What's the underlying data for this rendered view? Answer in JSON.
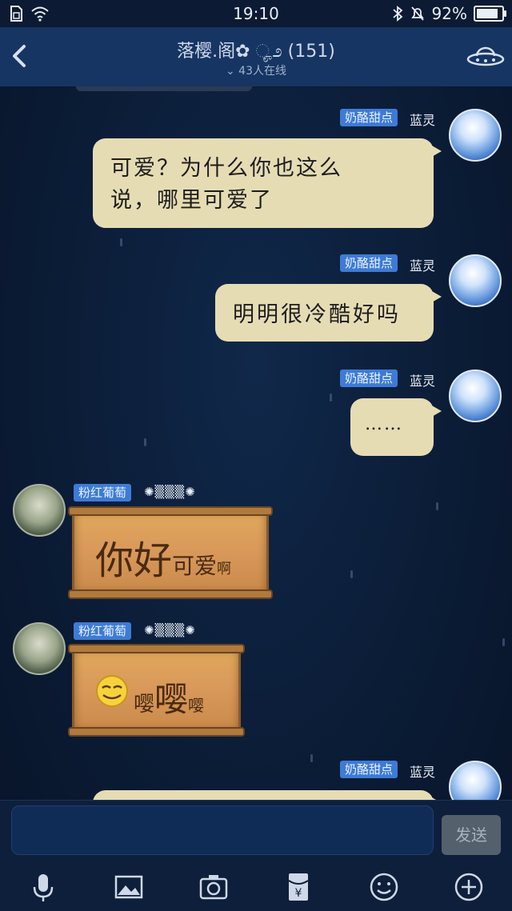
{
  "status_bar": {
    "time": "19:10",
    "battery_percent": "92%",
    "battery_level": 0.92
  },
  "header": {
    "title": "落樱.阁✿ ೄ೨ (151)",
    "online": "43人在线",
    "back_icon": "chevron-left-icon",
    "right_icon": "ufo-icon"
  },
  "messages": [
    {
      "side": "right",
      "tag": "奶酪甜点",
      "name": "蓝灵",
      "text_line1": "可爱？为什么你也这么",
      "text_line2": "说，哪里可爱了"
    },
    {
      "side": "right",
      "tag": "奶酪甜点",
      "name": "蓝灵",
      "text": "明明很冷酷好吗"
    },
    {
      "side": "right",
      "tag": "奶酪甜点",
      "name": "蓝灵",
      "text": "……"
    },
    {
      "side": "left",
      "tag": "粉红葡萄",
      "deco": "✺▒▒▒✺",
      "big": "你好",
      "mid": "可爱",
      "small": "啊"
    },
    {
      "side": "left",
      "tag": "粉红葡萄",
      "deco": "✺▒▒▒✺",
      "w1": "嘤",
      "w2": "嘤",
      "w3": "嘤"
    },
    {
      "side": "right",
      "tag": "奶酪甜点",
      "name": "蓝灵"
    }
  ],
  "input": {
    "value": "",
    "send_label": "发送"
  },
  "toolbar": {
    "icons": [
      "microphone-icon",
      "image-icon",
      "camera-icon",
      "red-packet-icon",
      "emoji-icon",
      "plus-icon"
    ]
  }
}
